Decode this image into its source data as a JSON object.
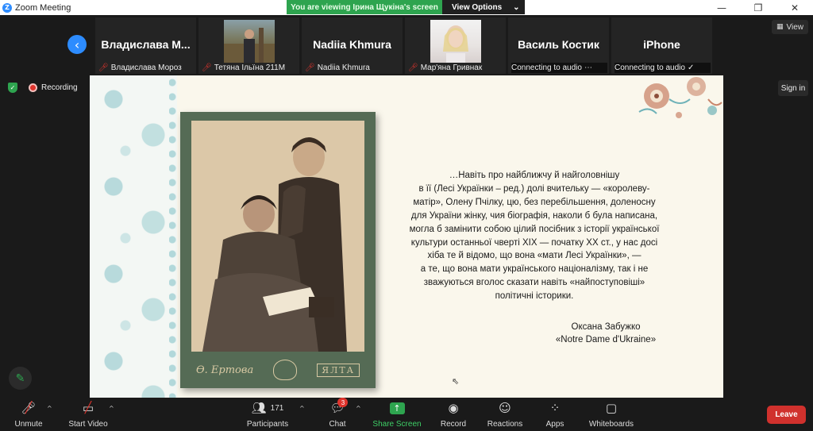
{
  "window": {
    "title": "Zoom Meeting",
    "controls": [
      "—",
      "❐",
      "✕"
    ]
  },
  "share_banner": {
    "message": "You are viewing Ірина Щукіна's screen",
    "options_label": "View Options",
    "options_chevron": "⌄"
  },
  "participants_strip": [
    {
      "display_name": "Владислава  М...",
      "label": "Владислава Мороз",
      "muted": true,
      "has_video": false
    },
    {
      "display_name": "",
      "label": "Тетяна Ільїна 211М",
      "muted": true,
      "has_video": true
    },
    {
      "display_name": "Nadiia Khmura",
      "label": "Nadiia Khmura",
      "muted": true,
      "has_video": false
    },
    {
      "display_name": "",
      "label": "Мар'яна Гривнак",
      "muted": true,
      "has_video": true
    },
    {
      "display_name": "Василь Костик",
      "label": "Connecting to audio",
      "muted": false,
      "has_video": false
    },
    {
      "display_name": "iPhone",
      "label": "Connecting to audio",
      "muted": false,
      "has_video": false
    }
  ],
  "view_button": {
    "label": "View",
    "icon": "grid-icon"
  },
  "recording": {
    "label": "Recording"
  },
  "sign_in": {
    "label": "Sign in"
  },
  "slide": {
    "quote_lines": [
      "…Навіть про найближчу й найголовнішу",
      "в її (Лесі Українки – ред.) долі вчительку — «королеву-",
      "матір», Олену Пчілку, цю, без перебільшення, доленосну",
      "для України жінку, чия біографія, наколи б була написана,",
      "могла б замінити собою цілий посібник з історії української",
      "культури останньої чверті XIX — початку XX ст., у нас досі",
      "хіба  те й відомо, що вона «мати Лесі Українки», —",
      "а те, що вона мати українського націоналізму, так і не",
      "зважуються вголос сказати навіть «найпоступовіші»",
      "політичні історики."
    ],
    "author": "Оксана Забужко",
    "book": "«Notre Dame d'Ukraine»",
    "photo_signature": "Ѳ. Ертова",
    "photo_city": "ЯЛТА"
  },
  "toolbar": {
    "unmute": "Unmute",
    "start_video": "Start Video",
    "participants": "Participants",
    "participants_count": "171",
    "chat": "Chat",
    "chat_badge": "3",
    "share_screen": "Share Screen",
    "record": "Record",
    "reactions": "Reactions",
    "apps": "Apps",
    "whiteboards": "Whiteboards",
    "leave": "Leave"
  },
  "colors": {
    "accent": "#2d8cff",
    "share_green": "#2ea44f",
    "leave_red": "#d0312d",
    "slide_bg": "#faf7ec",
    "photo_frame": "#556b55"
  }
}
